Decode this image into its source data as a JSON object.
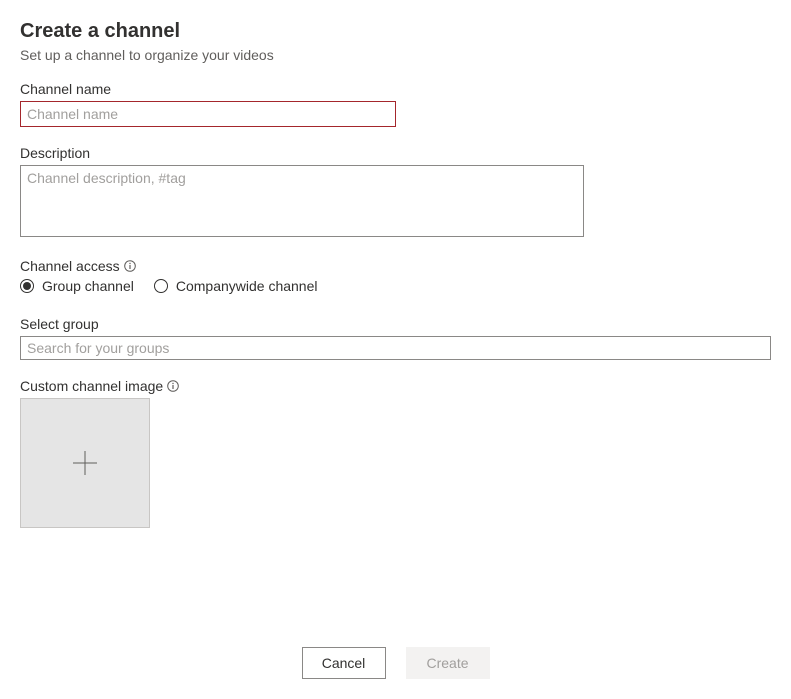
{
  "header": {
    "title": "Create a channel",
    "subtitle": "Set up a channel to organize your videos"
  },
  "channelName": {
    "label": "Channel name",
    "placeholder": "Channel name",
    "value": ""
  },
  "description": {
    "label": "Description",
    "placeholder": "Channel description, #tag",
    "value": ""
  },
  "channelAccess": {
    "label": "Channel access",
    "options": {
      "group": "Group channel",
      "companywide": "Companywide channel"
    },
    "selected": "group"
  },
  "selectGroup": {
    "label": "Select group",
    "placeholder": "Search for your groups",
    "value": ""
  },
  "customImage": {
    "label": "Custom channel image"
  },
  "footer": {
    "cancel": "Cancel",
    "create": "Create"
  }
}
